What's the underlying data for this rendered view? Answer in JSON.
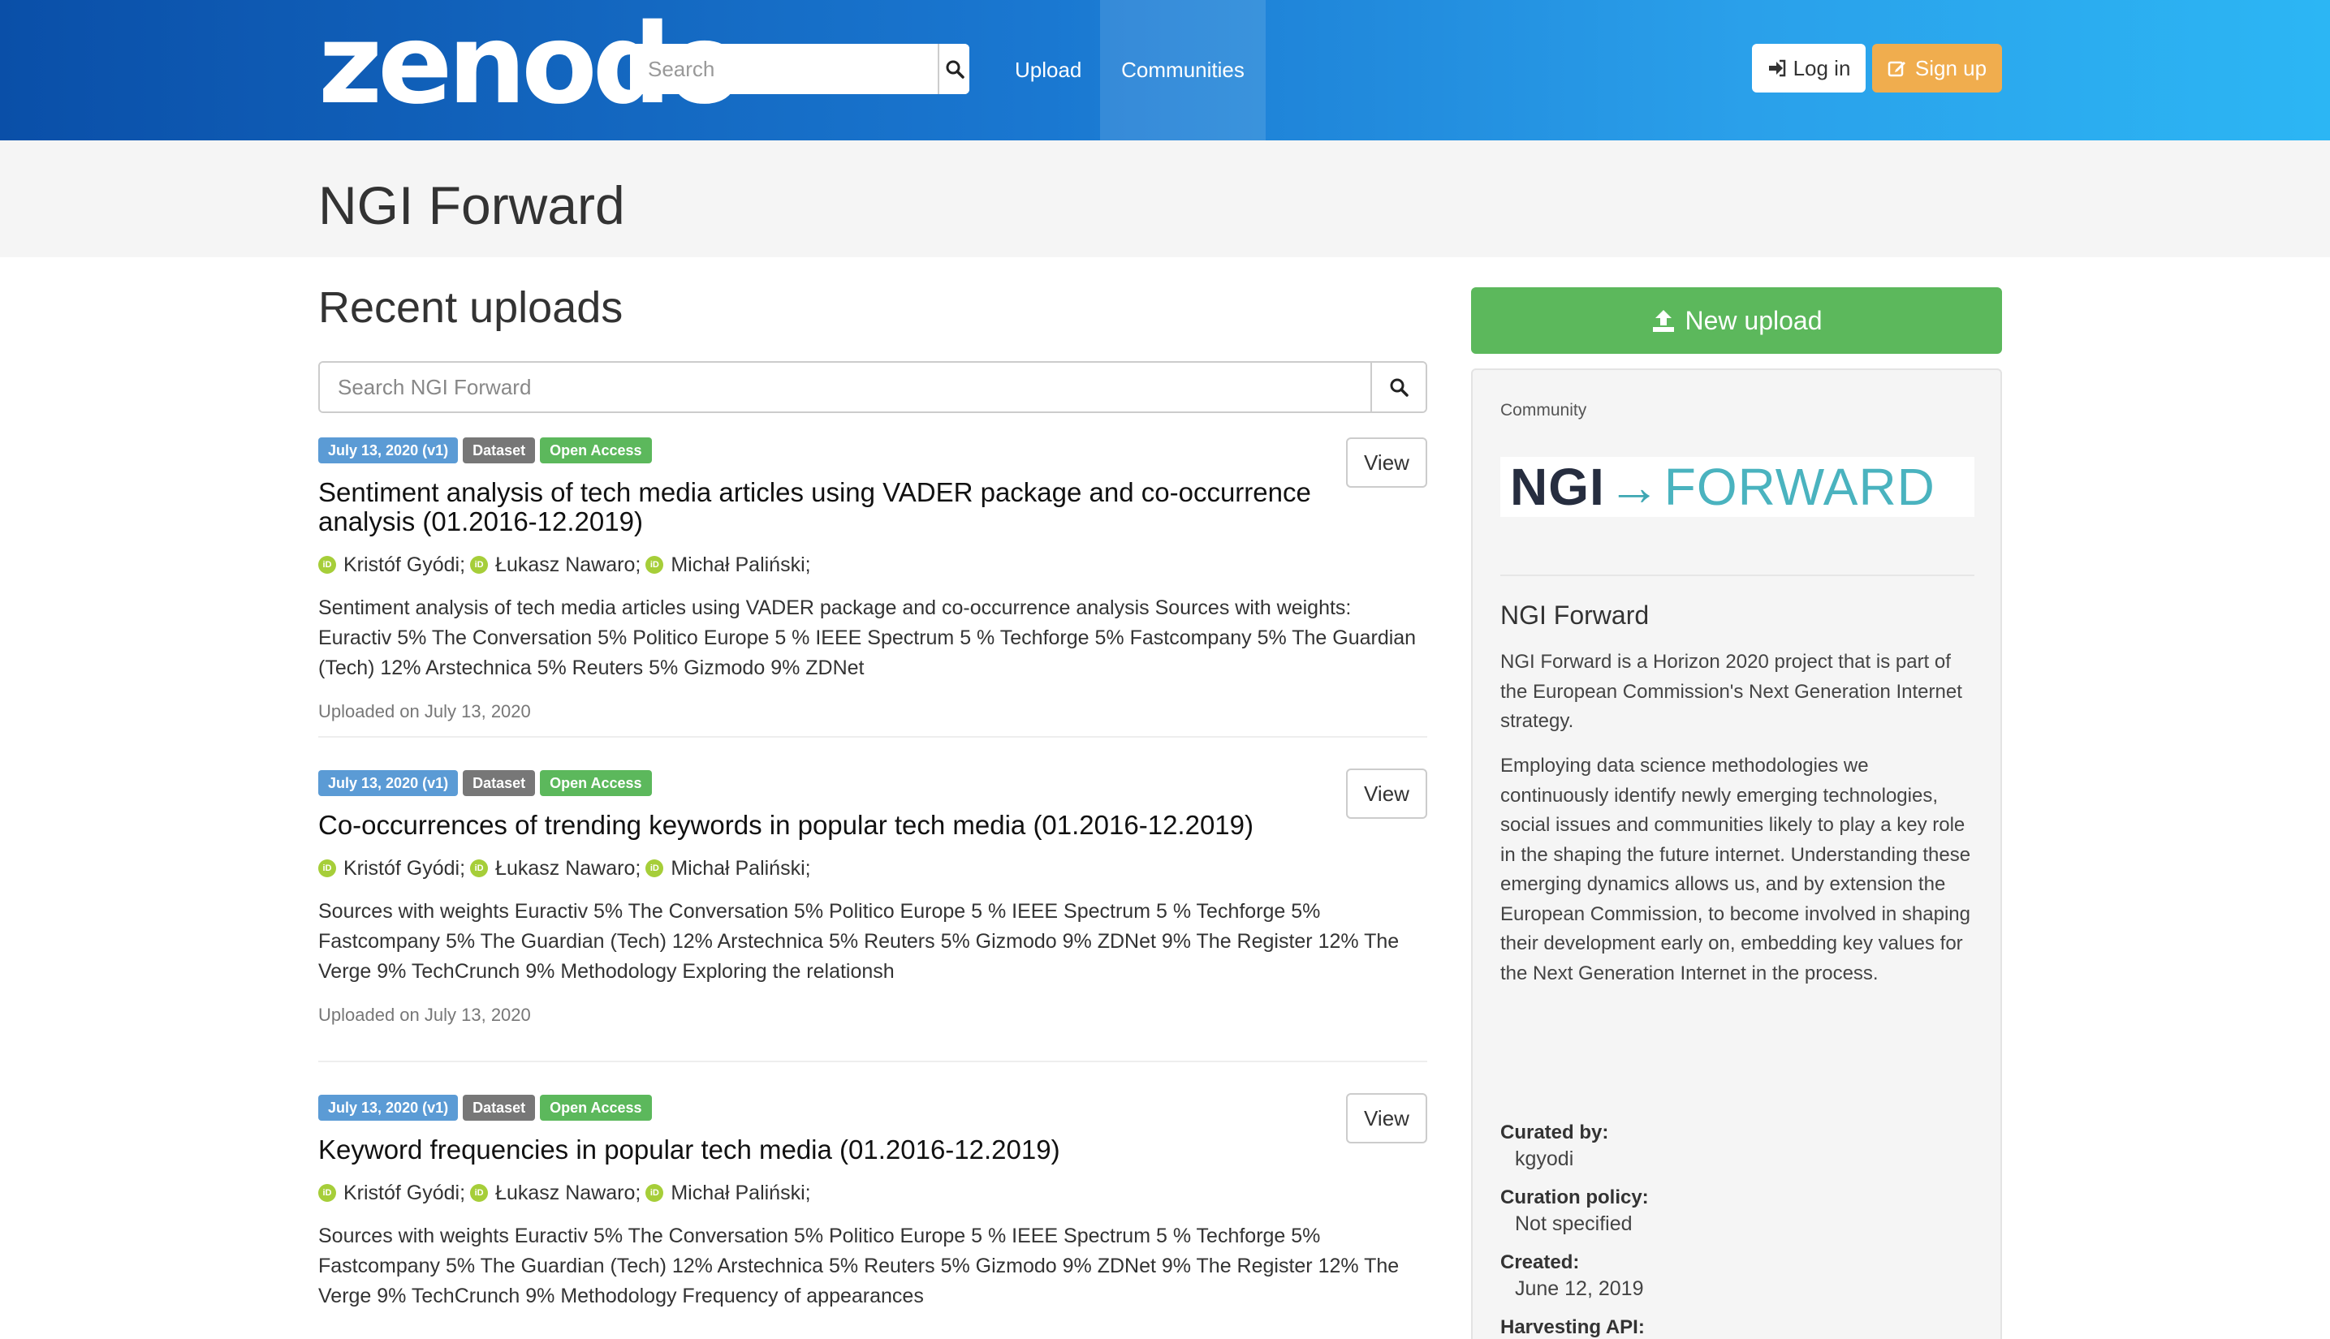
{
  "navbar": {
    "logo_text": "zenodo",
    "search_placeholder": "Search",
    "links": {
      "upload": "Upload",
      "communities": "Communities"
    },
    "login_label": "Log in",
    "signup_label": "Sign up"
  },
  "page": {
    "title": "NGI Forward"
  },
  "main": {
    "section_title": "Recent uploads",
    "search_placeholder": "Search NGI Forward",
    "view_label": "View",
    "records": [
      {
        "badges": {
          "date": "July 13, 2020 (v1)",
          "type": "Dataset",
          "access": "Open Access"
        },
        "title": "Sentiment analysis of tech media articles using VADER package and co-occurrence analysis (01.2016-12.2019)",
        "authors": [
          "Kristóf Gyódi;",
          "Łukasz Nawaro;",
          "Michał Paliński;"
        ],
        "description": "Sentiment analysis of tech media articles using VADER package and co-occurrence analysis Sources with weights: Euractiv 5% The Conversation 5% Politico Europe 5 % IEEE Spectrum 5 % Techforge 5% Fastcompany 5% The Guardian (Tech) 12% Arstechnica 5% Reuters 5% Gizmodo 9% ZDNet",
        "uploaded": "Uploaded on July 13, 2020"
      },
      {
        "badges": {
          "date": "July 13, 2020 (v1)",
          "type": "Dataset",
          "access": "Open Access"
        },
        "title": "Co-occurrences of trending keywords in popular tech media (01.2016-12.2019)",
        "authors": [
          "Kristóf Gyódi;",
          "Łukasz Nawaro;",
          "Michał Paliński;"
        ],
        "description": "Sources with weights Euractiv 5% The Conversation 5% Politico Europe 5 % IEEE Spectrum 5 % Techforge 5% Fastcompany 5% The Guardian (Tech) 12% Arstechnica 5% Reuters 5% Gizmodo 9% ZDNet 9% The Register 12% The Verge 9% TechCrunch 9% Methodology Exploring the relationsh",
        "uploaded": "Uploaded on July 13, 2020"
      },
      {
        "badges": {
          "date": "July 13, 2020 (v1)",
          "type": "Dataset",
          "access": "Open Access"
        },
        "title": "Keyword frequencies in popular tech media (01.2016-12.2019)",
        "authors": [
          "Kristóf Gyódi;",
          "Łukasz Nawaro;",
          "Michał Paliński;"
        ],
        "description": "Sources with weights Euractiv 5% The Conversation 5% Politico Europe 5 % IEEE Spectrum 5 % Techforge 5% Fastcompany 5% The Guardian (Tech) 12% Arstechnica 5% Reuters 5% Gizmodo 9% ZDNet 9% The Register 12% The Verge 9% TechCrunch 9% Methodology Frequency of appearances",
        "uploaded": ""
      }
    ]
  },
  "sidebar": {
    "new_upload_label": "New upload",
    "label": "Community",
    "logo": {
      "ngi": "NGI",
      "arrow": "→",
      "forward": "FORWARD"
    },
    "name": "NGI Forward",
    "paragraph1": "NGI Forward is a Horizon 2020 project that is part of the European Commission's Next Generation Internet strategy.",
    "paragraph2": "Employing data science methodologies we continuously identify newly emerging technologies, social issues and communities likely to play a key role in the shaping the future internet. Understanding these emerging dynamics allows us, and by extension the European Commission, to become involved in shaping their development early on, embedding key values for the Next Generation Internet in the process.",
    "curated_by_label": "Curated by:",
    "curated_by": "kgyodi",
    "curation_policy_label": "Curation policy:",
    "curation_policy": "Not specified",
    "created_label": "Created:",
    "created": "June 12, 2019",
    "harvesting_label": "Harvesting API:"
  },
  "colors": {
    "navbar_start": "#0a4fa8",
    "navbar_end": "#2cb6f4",
    "signup": "#f0ad4e",
    "new_upload": "#5cb85c",
    "badge_date": "#5b9bd5",
    "badge_type": "#777777",
    "badge_access": "#5cb85c",
    "orcid": "#a6ce39"
  },
  "icons": {
    "search": "search-icon",
    "login": "sign-in-icon",
    "signup": "edit-icon",
    "upload": "upload-icon",
    "orcid": "orcid-icon"
  }
}
